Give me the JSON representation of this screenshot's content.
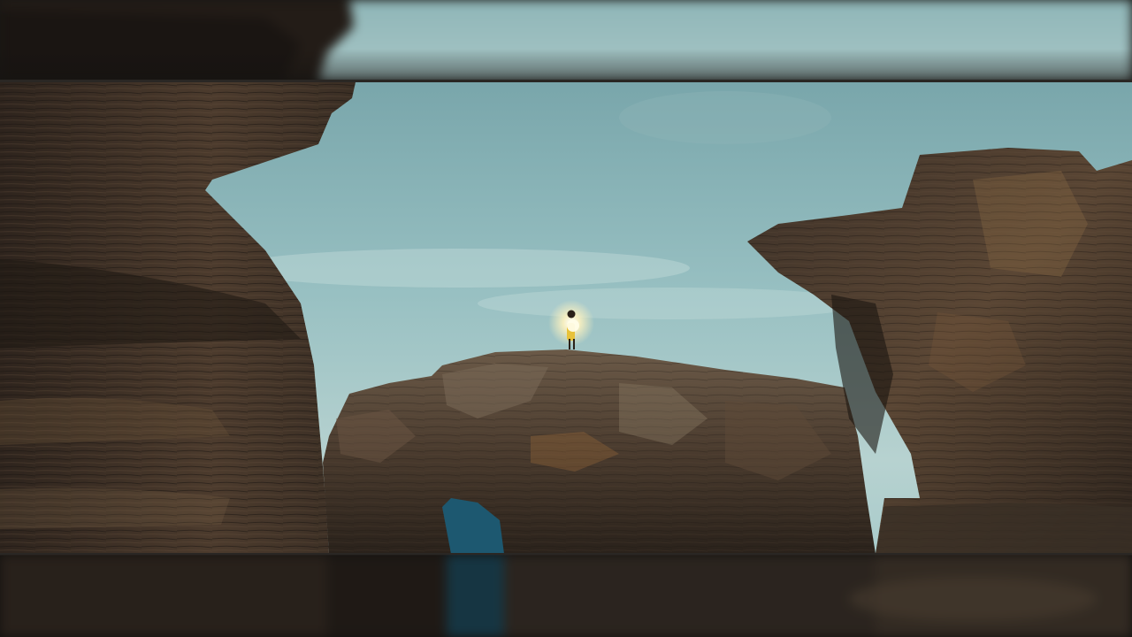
{
  "scene": {
    "subject": "person-with-lantern",
    "palette": {
      "sky_top": "#7aa8ad",
      "sky_mid": "#9ec4c6",
      "sky_horizon": "#b9d4d2",
      "rock_dark": "#2a211b",
      "rock_mid": "#4a3a2c",
      "rock_light": "#7a6048",
      "sea": "#1f5a70",
      "lantern_glow": "#fff6c8",
      "coat": "#e8c23a"
    }
  }
}
